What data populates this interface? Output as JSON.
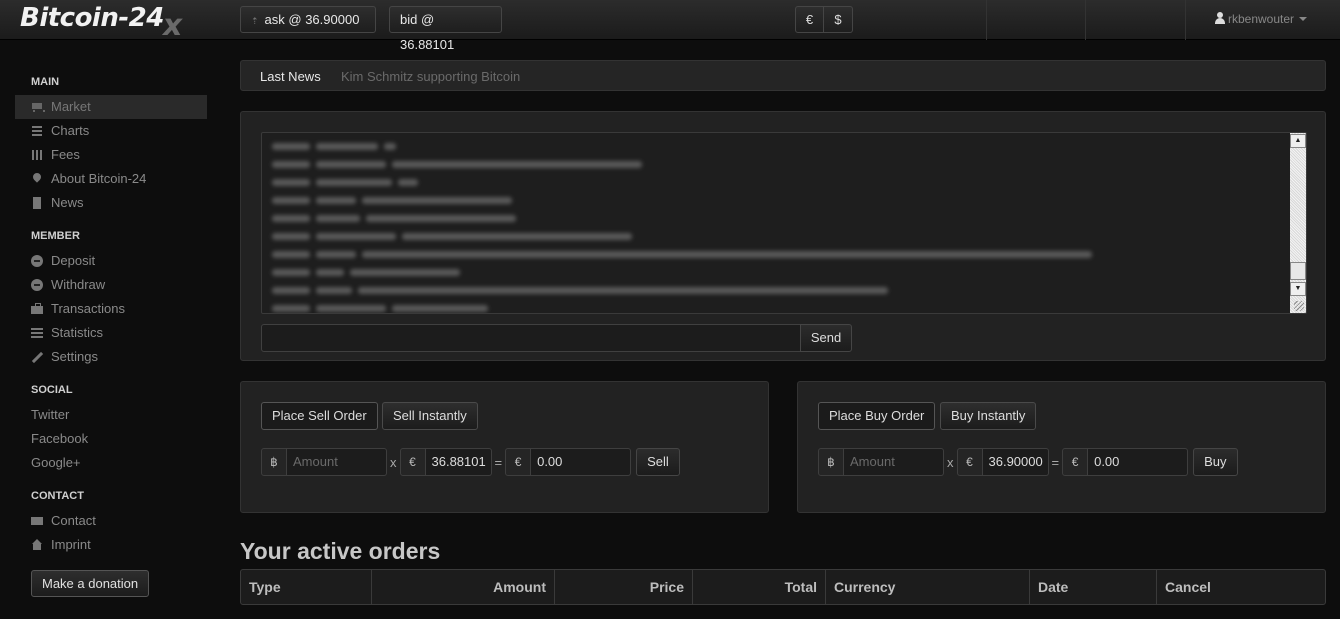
{
  "header": {
    "logo": "Bitcoin-24",
    "logo_mark": "x",
    "ask_label": "ask @ 36.90000",
    "bid_label": "bid @ 36.88101",
    "currencies": [
      "€",
      "$"
    ],
    "username": "rkbenwouter"
  },
  "sidebar": {
    "main_title": "MAIN",
    "main_items": [
      "Market",
      "Charts",
      "Fees",
      "About Bitcoin-24",
      "News"
    ],
    "member_title": "MEMBER",
    "member_items": [
      "Deposit",
      "Withdraw",
      "Transactions",
      "Statistics",
      "Settings"
    ],
    "social_title": "SOCIAL",
    "social_items": [
      "Twitter",
      "Facebook",
      "Google+"
    ],
    "contact_title": "CONTACT",
    "contact_items": [
      "Contact",
      "Imprint"
    ],
    "donate_label": "Make a donation"
  },
  "news": {
    "label": "Last News",
    "headline": "Kim Schmitz supporting Bitcoin"
  },
  "chat": {
    "send_label": "Send",
    "input_value": ""
  },
  "sell": {
    "tab_order": "Place Sell Order",
    "tab_instant": "Sell Instantly",
    "btc_symbol": "฿",
    "amount_placeholder": "Amount",
    "times": "x",
    "eur_symbol": "€",
    "price": "36.88101",
    "equals": "=",
    "total": "0.00",
    "action": "Sell"
  },
  "buy": {
    "tab_order": "Place Buy Order",
    "tab_instant": "Buy Instantly",
    "btc_symbol": "฿",
    "amount_placeholder": "Amount",
    "times": "x",
    "eur_symbol": "€",
    "price": "36.90000",
    "equals": "=",
    "total": "0.00",
    "action": "Buy"
  },
  "orders": {
    "title": "Your active orders",
    "columns": [
      "Type",
      "Amount",
      "Price",
      "Total",
      "Currency",
      "Date",
      "Cancel"
    ]
  }
}
